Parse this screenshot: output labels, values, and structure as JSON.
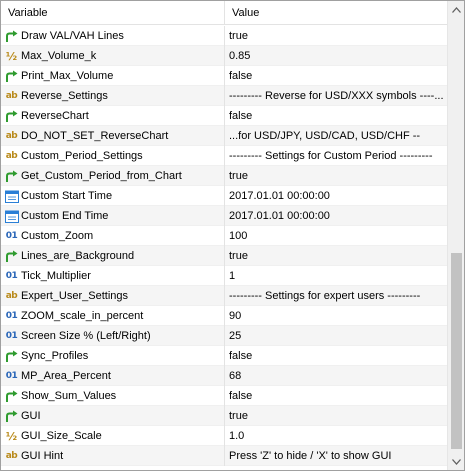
{
  "header": {
    "variable": "Variable",
    "value": "Value"
  },
  "icon_colors": {
    "bool": "#2e9b2e",
    "string": "#b98a1a",
    "int": "#2a66b8",
    "datetime": "#2a7fd6"
  },
  "rows": [
    {
      "icon": "bool",
      "name": "Draw VAL/VAH Lines",
      "value": "true"
    },
    {
      "icon": "double",
      "name": "Max_Volume_k",
      "value": "0.85"
    },
    {
      "icon": "bool",
      "name": "Print_Max_Volume",
      "value": "false"
    },
    {
      "icon": "string",
      "name": "Reverse_Settings",
      "value": "--------- Reverse for USD/XXX symbols ----..."
    },
    {
      "icon": "bool",
      "name": "ReverseChart",
      "value": "false"
    },
    {
      "icon": "string",
      "name": "DO_NOT_SET_ReverseChart",
      "value": "...for USD/JPY, USD/CAD, USD/CHF --"
    },
    {
      "icon": "string",
      "name": "Custom_Period_Settings",
      "value": "--------- Settings for Custom Period ---------"
    },
    {
      "icon": "bool",
      "name": "Get_Custom_Period_from_Chart",
      "value": "true"
    },
    {
      "icon": "datetime",
      "name": "Custom Start Time",
      "value": "2017.01.01 00:00:00"
    },
    {
      "icon": "datetime",
      "name": "Custom End Time",
      "value": "2017.01.01 00:00:00"
    },
    {
      "icon": "int",
      "name": "Custom_Zoom",
      "value": "100"
    },
    {
      "icon": "bool",
      "name": "Lines_are_Background",
      "value": "true"
    },
    {
      "icon": "int",
      "name": "Tick_Multiplier",
      "value": "1"
    },
    {
      "icon": "string",
      "name": "Expert_User_Settings",
      "value": "--------- Settings for expert users ---------"
    },
    {
      "icon": "int",
      "name": "ZOOM_scale_in_percent",
      "value": "90"
    },
    {
      "icon": "int",
      "name": "Screen Size % (Left/Right)",
      "value": "25"
    },
    {
      "icon": "bool",
      "name": "Sync_Profiles",
      "value": "false"
    },
    {
      "icon": "int",
      "name": "MP_Area_Percent",
      "value": "68"
    },
    {
      "icon": "bool",
      "name": "Show_Sum_Values",
      "value": "false"
    },
    {
      "icon": "bool",
      "name": "GUI",
      "value": "true"
    },
    {
      "icon": "double",
      "name": "GUI_Size_Scale",
      "value": "1.0"
    },
    {
      "icon": "string",
      "name": "GUI Hint",
      "value": "Press 'Z' to hide / 'X' to show GUI"
    }
  ],
  "icon_glyphs": {
    "string": "ab",
    "int": "01",
    "double": "½"
  },
  "scrollbar": {
    "up": "▲",
    "down": "▼"
  }
}
